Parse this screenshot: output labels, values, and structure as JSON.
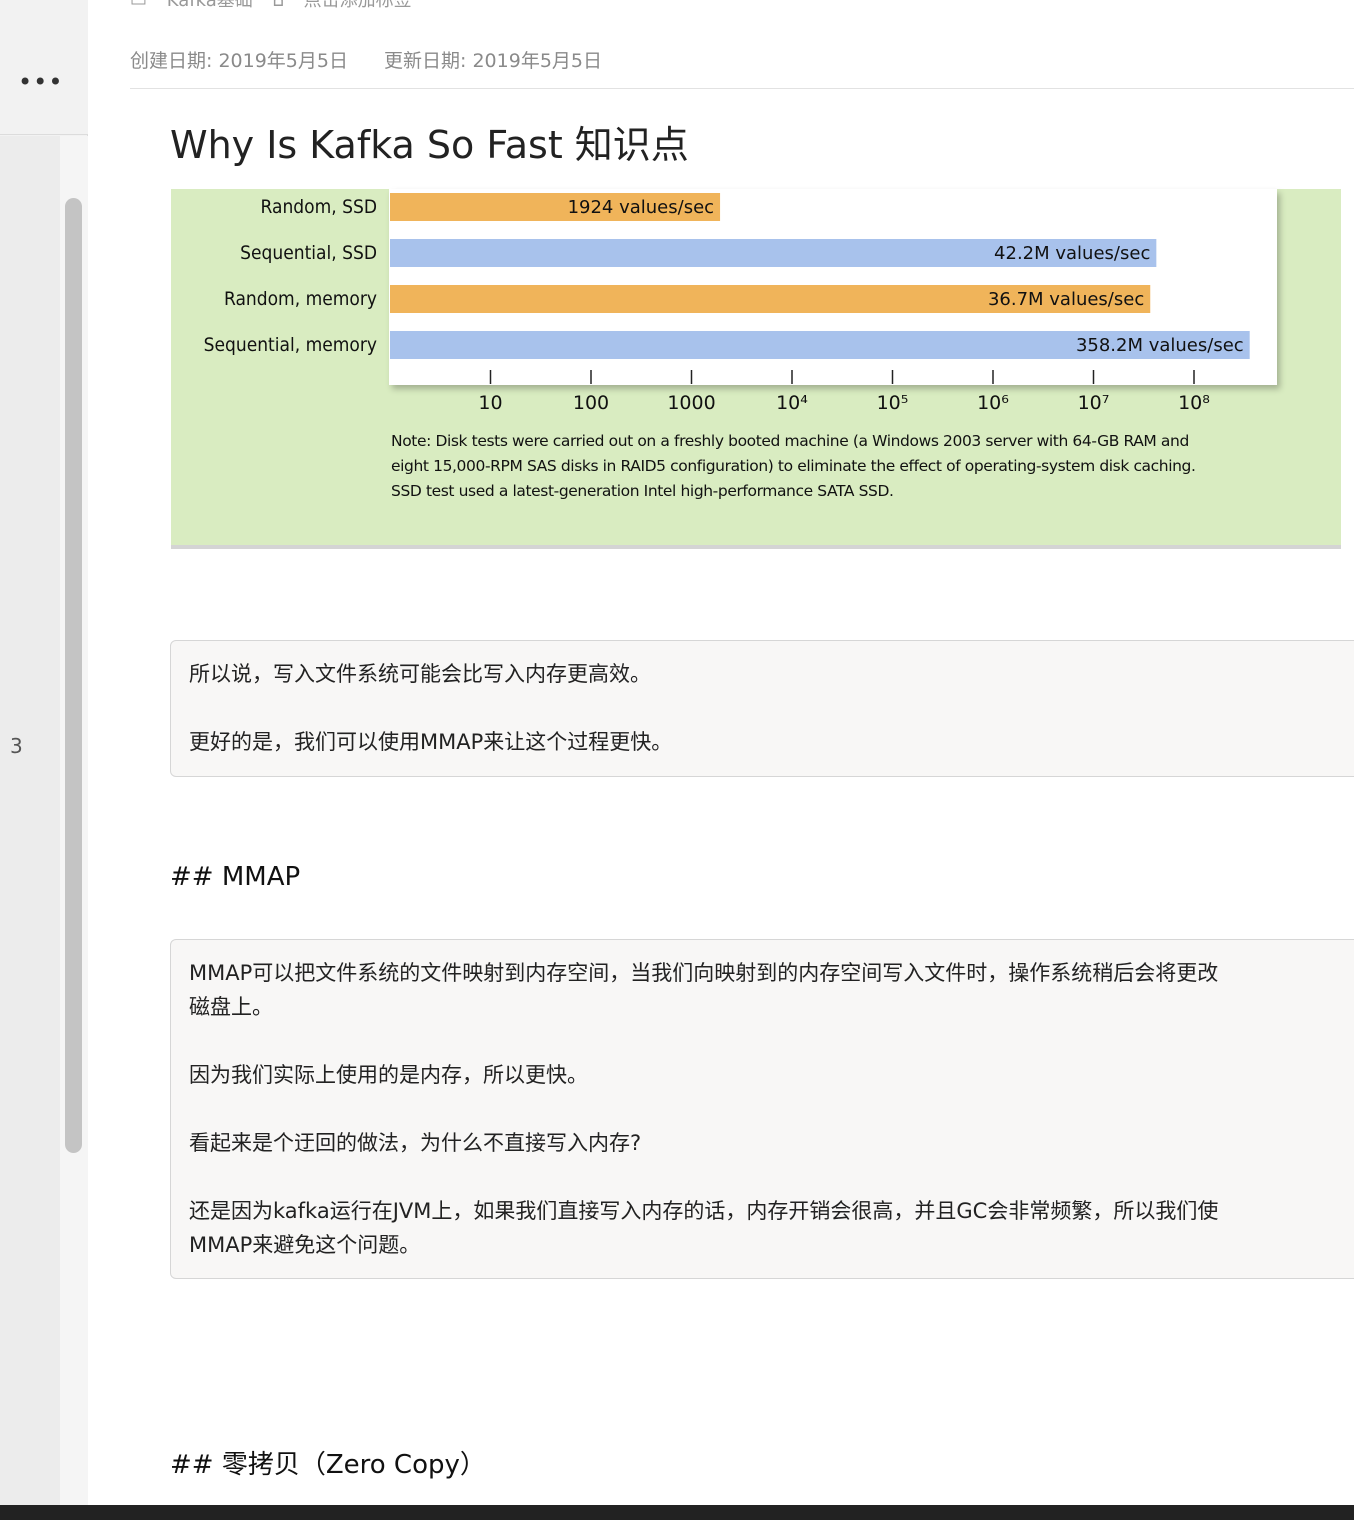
{
  "sidebar": {
    "more_label": "•••",
    "list_count": "3"
  },
  "note_header": {
    "notebook": "Kafka基础",
    "tag_placeholder": "点击添加标签",
    "created": "创建日期: 2019年5月5日",
    "updated": "更新日期: 2019年5月5日"
  },
  "title": "Why Is Kafka So Fast 知识点",
  "chart_data": {
    "type": "bar",
    "orientation": "horizontal",
    "log_scale": true,
    "categories": [
      "Random, SSD",
      "Sequential, SSD",
      "Random, memory",
      "Sequential, memory"
    ],
    "values": [
      1924,
      42200000,
      36700000,
      358200000
    ],
    "value_labels": [
      "1924 values/sec",
      "42.2M values/sec",
      "36.7M values/sec",
      "358.2M values/sec"
    ],
    "colors": [
      "#f0b45a",
      "#a8c2ec",
      "#f0b45a",
      "#a8c2ec"
    ],
    "ticks": [
      "10",
      "100",
      "1000",
      "10⁴",
      "10⁵",
      "10⁶",
      "10⁷",
      "10⁸"
    ],
    "xlim": [
      1,
      1000000000
    ],
    "note": "Note: Disk tests were carried out on a freshly booted machine (a Windows 2003 server with 64-GB RAM and eight 15,000-RPM SAS disks in RAID5 configuration) to eliminate the effect of operating-system disk caching. SSD test used a latest-generation Intel high-performance SATA SSD."
  },
  "quote1": {
    "p1": "所以说，写入文件系统可能会比写入内存更高效。",
    "p2": "更好的是，我们可以使用MMAP来让这个过程更快。"
  },
  "heading_mmap": "## MMAP",
  "quote2": {
    "p1a": "MMAP可以把文件系统的文件映射到内存空间，当我们向映射到的内存空间写入文件时，操作系统稍后会将更改",
    "p1b": "磁盘上。",
    "p2": "因为我们实际上使用的是内存，所以更快。",
    "p3": "看起来是个迂回的做法，为什么不直接写入内存?",
    "p4a": "还是因为kafka运行在JVM上，如果我们直接写入内存的话，内存开销会很高，并且GC会非常频繁，所以我们使",
    "p4b": "MMAP来避免这个问题。"
  },
  "heading_zero_copy": "## 零拷贝（Zero Copy）"
}
